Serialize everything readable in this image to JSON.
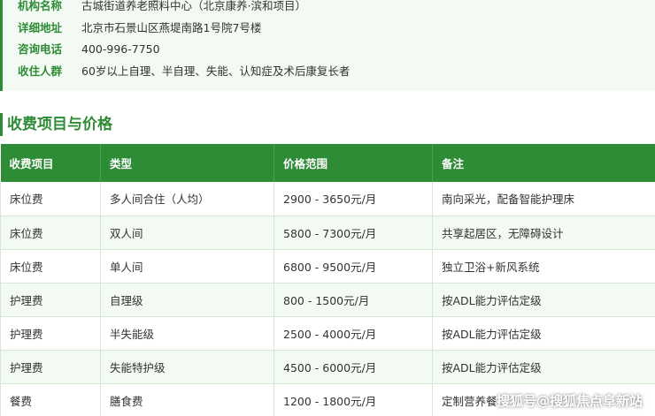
{
  "info": {
    "rows": [
      {
        "label": "机构名称",
        "value": "古城街道养老照料中心（北京康养·滨和项目）"
      },
      {
        "label": "详细地址",
        "value": "北京市石景山区燕堤南路1号院7号楼"
      },
      {
        "label": "咨询电话",
        "value": "400-996-7750"
      },
      {
        "label": "收住人群",
        "value": "60岁以上自理、半自理、失能、认知症及术后康复长者"
      }
    ]
  },
  "section": {
    "title": "收费项目与价格"
  },
  "table": {
    "headers": [
      "收费项目",
      "类型",
      "价格范围",
      "备注"
    ],
    "rows": [
      [
        "床位费",
        "多人间合住（人均）",
        "2900 - 3650元/月",
        "南向采光，配备智能护理床"
      ],
      [
        "床位费",
        "双人间",
        "5800 - 7300元/月",
        "共享起居区，无障碍设计"
      ],
      [
        "床位费",
        "单人间",
        "6800 - 9500元/月",
        "独立卫浴+新风系统"
      ],
      [
        "护理费",
        "自理级",
        "800 - 1500元/月",
        "按ADL能力评估定级"
      ],
      [
        "护理费",
        "半失能级",
        "2500 - 4000元/月",
        "按ADL能力评估定级"
      ],
      [
        "护理费",
        "失能特护级",
        "4500 - 6000元/月",
        "按ADL能力评估定级"
      ],
      [
        "餐费",
        "膳食费",
        "1200 - 1800元/月",
        "定制营养餐"
      ]
    ]
  },
  "watermark": "搜狐号@搜狐焦点阜新站",
  "colors": {
    "accent": "#2e8b36",
    "row_alt": "#f3f9f3",
    "text": "#333333"
  }
}
